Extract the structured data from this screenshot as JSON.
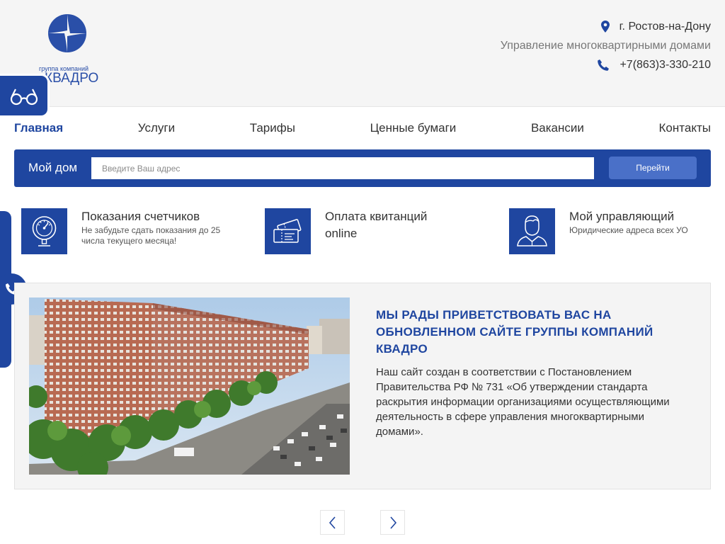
{
  "logo": {
    "subtitle": "группа компаний",
    "name": "КВАДРО"
  },
  "contact": {
    "city": "г. Ростов-на-Дону",
    "tagline": "Управление многоквартирными домами",
    "phone": "+7(863)3-330-210"
  },
  "nav": {
    "items": [
      {
        "label": "Главная"
      },
      {
        "label": "Услуги"
      },
      {
        "label": "Тарифы"
      },
      {
        "label": "Ценные бумаги"
      },
      {
        "label": "Вакансии"
      },
      {
        "label": "Контакты"
      }
    ]
  },
  "search": {
    "label": "Мой дом",
    "placeholder": "Введите Ваш адрес",
    "button": "Перейти"
  },
  "quicklinks": [
    {
      "title": "Показания счетчиков",
      "desc": "Не забудьте сдать показания до 25 числа текущего месяца!",
      "icon": "meter-gauge-icon"
    },
    {
      "title": "Оплата квитанций online",
      "desc": "",
      "icon": "tickets-icon"
    },
    {
      "title": "Мой управляющий",
      "desc": "Юридические адреса всех УО",
      "icon": "manager-person-icon"
    }
  ],
  "slide": {
    "headline": "МЫ РАДЫ ПРИВЕТСТВОВАТЬ ВАС НА ОБНОВЛЕННОМ САЙТЕ ГРУППЫ КОМПАНИЙ КВАДРО",
    "text": "Наш сайт создан в соответствии с Постановлением Правительства РФ № 731 «Об утверждении стандарта раскрытия информации организациями осуществляющими деятельность в сфере управления многоквартирными домами»."
  },
  "colors": {
    "brand": "#1f46a0",
    "button": "#4a70c8",
    "header_bg": "#f5f5f5"
  }
}
